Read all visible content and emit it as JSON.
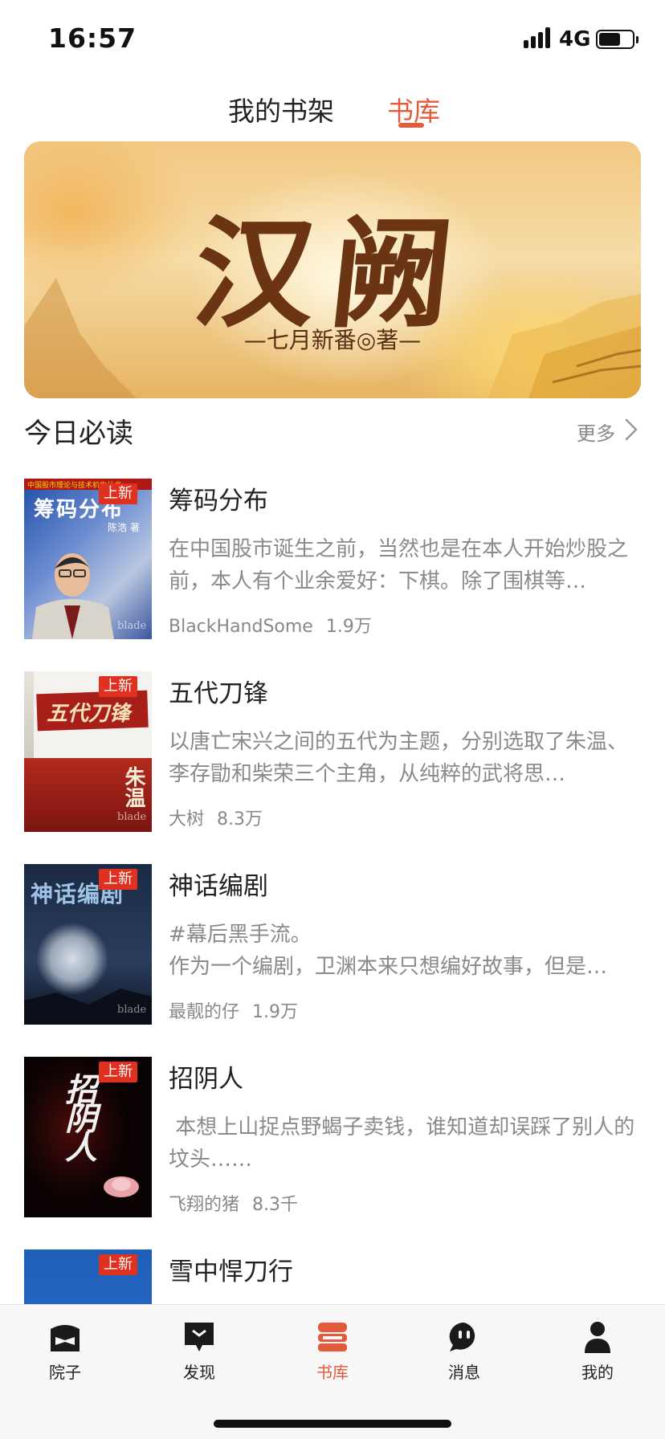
{
  "status_bar": {
    "time": "16:57",
    "network": "4G",
    "battery_level": 0.65
  },
  "top_tabs": [
    {
      "label": "我的书架",
      "active": false
    },
    {
      "label": "书库",
      "active": true
    }
  ],
  "accent_color": "#e35a3a",
  "banner": {
    "title": "汉阙",
    "author": "—七月新番◎著—"
  },
  "section": {
    "title": "今日必读",
    "more_label": "更多",
    "more_icon": "chevron-right-icon"
  },
  "books": [
    {
      "title": "筹码分布",
      "badge": "上新",
      "description": "在中国股市诞生之前，当然也是在本人开始炒股之前，本人有个业余爱好：下棋。除了围棋等…",
      "author": "BlackHandSome",
      "count": "1.9万",
      "cover": {
        "title": "筹码分布",
        "byline": "陈浩 著",
        "top_line": "中国股市理论与技术机构丛书",
        "watermark": "blade"
      }
    },
    {
      "title": "五代刀锋",
      "badge": "上新",
      "description": "以唐亡宋兴之间的五代为主题，分别选取了朱温、李存勖和柴荣三个主角，从纯粹的武将思…",
      "author": "大树",
      "count": "8.3万",
      "cover": {
        "title": "五代刀锋",
        "sub": "朱温",
        "watermark": "blade"
      }
    },
    {
      "title": "神话编剧",
      "badge": "上新",
      "description": "#幕后黑手流。\n作为一个编剧，卫渊本来只想编好故事，但是…",
      "author": "最靓的仔",
      "count": "1.9万",
      "cover": {
        "title": "神话编剧",
        "watermark": "blade"
      }
    },
    {
      "title": "招阴人",
      "badge": "上新",
      "description": " 本想上山捉点野蝎子卖钱，谁知道却误踩了别人的坟头……",
      "author": "飞翔的猪",
      "count": "8.3千",
      "cover": {
        "title": "招阴人"
      }
    },
    {
      "title": "雪中悍刀行",
      "badge": "上新",
      "description": "",
      "author": "",
      "count": "",
      "cover": {
        "title": ""
      }
    }
  ],
  "bottom_nav": [
    {
      "label": "院子",
      "icon": "courtyard-icon",
      "active": false
    },
    {
      "label": "发现",
      "icon": "discover-icon",
      "active": false
    },
    {
      "label": "书库",
      "icon": "library-icon",
      "active": true
    },
    {
      "label": "消息",
      "icon": "message-icon",
      "active": false
    },
    {
      "label": "我的",
      "icon": "profile-icon",
      "active": false
    }
  ]
}
